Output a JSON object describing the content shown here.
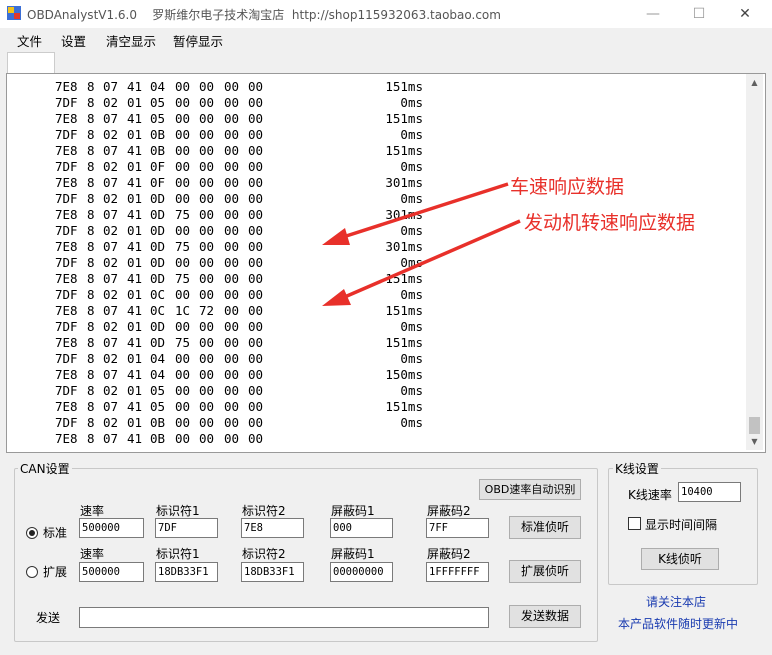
{
  "window": {
    "title": "OBDAnalystV1.6.0",
    "subtitle": "罗斯维尔电子技术淘宝店  http://shop115932063.taobao.com",
    "min_glyph": "—",
    "max_glyph": "☐",
    "close_glyph": "✕"
  },
  "menu": [
    "文件",
    "设置",
    "清空显示",
    "暂停显示"
  ],
  "log_rows": [
    [
      "7E8",
      "8",
      "07",
      "41",
      "04",
      "00",
      "00",
      "00",
      "00",
      "151ms"
    ],
    [
      "7DF",
      "8",
      "02",
      "01",
      "05",
      "00",
      "00",
      "00",
      "00",
      "0ms"
    ],
    [
      "7E8",
      "8",
      "07",
      "41",
      "05",
      "00",
      "00",
      "00",
      "00",
      "151ms"
    ],
    [
      "7DF",
      "8",
      "02",
      "01",
      "0B",
      "00",
      "00",
      "00",
      "00",
      "0ms"
    ],
    [
      "7E8",
      "8",
      "07",
      "41",
      "0B",
      "00",
      "00",
      "00",
      "00",
      "151ms"
    ],
    [
      "7DF",
      "8",
      "02",
      "01",
      "0F",
      "00",
      "00",
      "00",
      "00",
      "0ms"
    ],
    [
      "7E8",
      "8",
      "07",
      "41",
      "0F",
      "00",
      "00",
      "00",
      "00",
      "301ms"
    ],
    [
      "7DF",
      "8",
      "02",
      "01",
      "0D",
      "00",
      "00",
      "00",
      "00",
      "0ms"
    ],
    [
      "7E8",
      "8",
      "07",
      "41",
      "0D",
      "75",
      "00",
      "00",
      "00",
      "301ms"
    ],
    [
      "7DF",
      "8",
      "02",
      "01",
      "0D",
      "00",
      "00",
      "00",
      "00",
      "0ms"
    ],
    [
      "7E8",
      "8",
      "07",
      "41",
      "0D",
      "75",
      "00",
      "00",
      "00",
      "301ms"
    ],
    [
      "7DF",
      "8",
      "02",
      "01",
      "0D",
      "00",
      "00",
      "00",
      "00",
      "0ms"
    ],
    [
      "7E8",
      "8",
      "07",
      "41",
      "0D",
      "75",
      "00",
      "00",
      "00",
      "151ms"
    ],
    [
      "7DF",
      "8",
      "02",
      "01",
      "0C",
      "00",
      "00",
      "00",
      "00",
      "0ms"
    ],
    [
      "7E8",
      "8",
      "07",
      "41",
      "0C",
      "1C",
      "72",
      "00",
      "00",
      "151ms"
    ],
    [
      "7DF",
      "8",
      "02",
      "01",
      "0D",
      "00",
      "00",
      "00",
      "00",
      "0ms"
    ],
    [
      "7E8",
      "8",
      "07",
      "41",
      "0D",
      "75",
      "00",
      "00",
      "00",
      "151ms"
    ],
    [
      "7DF",
      "8",
      "02",
      "01",
      "04",
      "00",
      "00",
      "00",
      "00",
      "0ms"
    ],
    [
      "7E8",
      "8",
      "07",
      "41",
      "04",
      "00",
      "00",
      "00",
      "00",
      "150ms"
    ],
    [
      "7DF",
      "8",
      "02",
      "01",
      "05",
      "00",
      "00",
      "00",
      "00",
      "0ms"
    ],
    [
      "7E8",
      "8",
      "07",
      "41",
      "05",
      "00",
      "00",
      "00",
      "00",
      "151ms"
    ],
    [
      "7DF",
      "8",
      "02",
      "01",
      "0B",
      "00",
      "00",
      "00",
      "00",
      "0ms"
    ],
    [
      "7E8",
      "8",
      "07",
      "41",
      "0B",
      "00",
      "00",
      "00",
      "00",
      ""
    ]
  ],
  "annotations": {
    "speed": "车速响应数据",
    "rpm": "发动机转速响应数据",
    "color": "#e8302a"
  },
  "can": {
    "title": "CAN设置",
    "auto_detect_button": "OBD速率自动识别",
    "standard": {
      "radio_label": "标准",
      "selected": true,
      "labels": [
        "速率",
        "标识符1",
        "标识符2",
        "屏蔽码1",
        "屏蔽码2"
      ],
      "values": [
        "500000",
        "7DF",
        "7E8",
        "000",
        "7FF"
      ],
      "listen_button": "标准侦听"
    },
    "extended": {
      "radio_label": "扩展",
      "selected": false,
      "labels": [
        "速率",
        "标识符1",
        "标识符2",
        "屏蔽码1",
        "屏蔽码2"
      ],
      "values": [
        "500000",
        "18DB33F1",
        "18DB33F1",
        "00000000",
        "1FFFFFFF"
      ],
      "listen_button": "扩展侦听"
    },
    "send_label": "发送",
    "send_value": "",
    "send_button": "发送数据"
  },
  "kline": {
    "title": "K线设置",
    "rate_label": "K线速率",
    "rate_value": "10400",
    "show_interval_label": "显示时间间隔",
    "show_interval_checked": false,
    "listen_button": "K线侦听"
  },
  "links": {
    "follow_store": "请关注本店",
    "update_note": "本产品软件随时更新中"
  }
}
